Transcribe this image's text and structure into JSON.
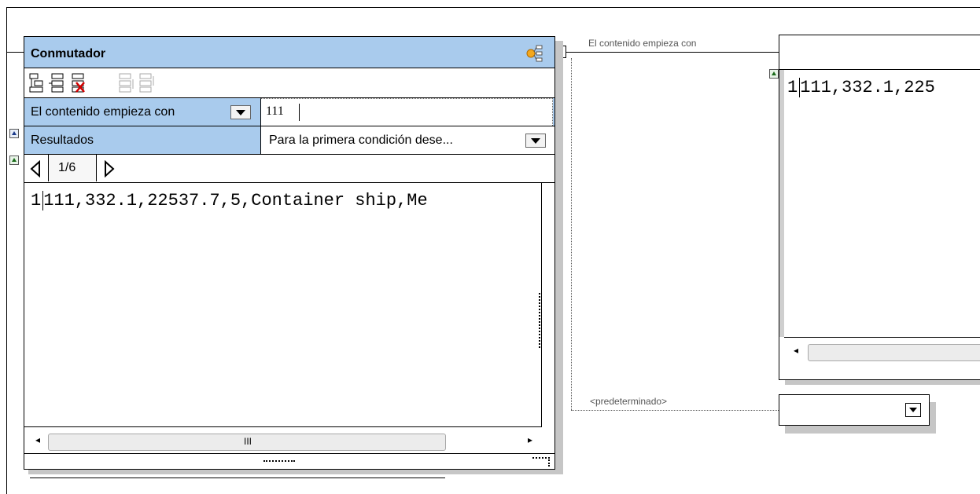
{
  "switch": {
    "title": "Conmutador",
    "condition_label": "El contenido empieza con",
    "condition_value": "111",
    "results_label": "Resultados",
    "results_option": "Para la primera condición dese...",
    "pager": "1/6",
    "line_number": "1",
    "line_text": "111,332.1,22537.7,5,Container ship,Me",
    "hscroll_thumb": "III"
  },
  "connections": {
    "condition_label": "El contenido empieza con",
    "default_label": "<predeterminado>"
  },
  "output": {
    "line_number": "1",
    "line_text": "111,332.1,225"
  },
  "icons": {
    "switch_icon": "switch-icon",
    "add_condition": "add-condition-icon",
    "insert_condition": "insert-condition-icon",
    "delete_condition": "delete-condition-icon",
    "move_up": "move-up-icon",
    "move_down": "move-down-icon",
    "prev": "previous-icon",
    "next": "next-icon"
  },
  "colors": {
    "header_blue": "#a9cbed",
    "shadow": "#c6c6c6"
  }
}
